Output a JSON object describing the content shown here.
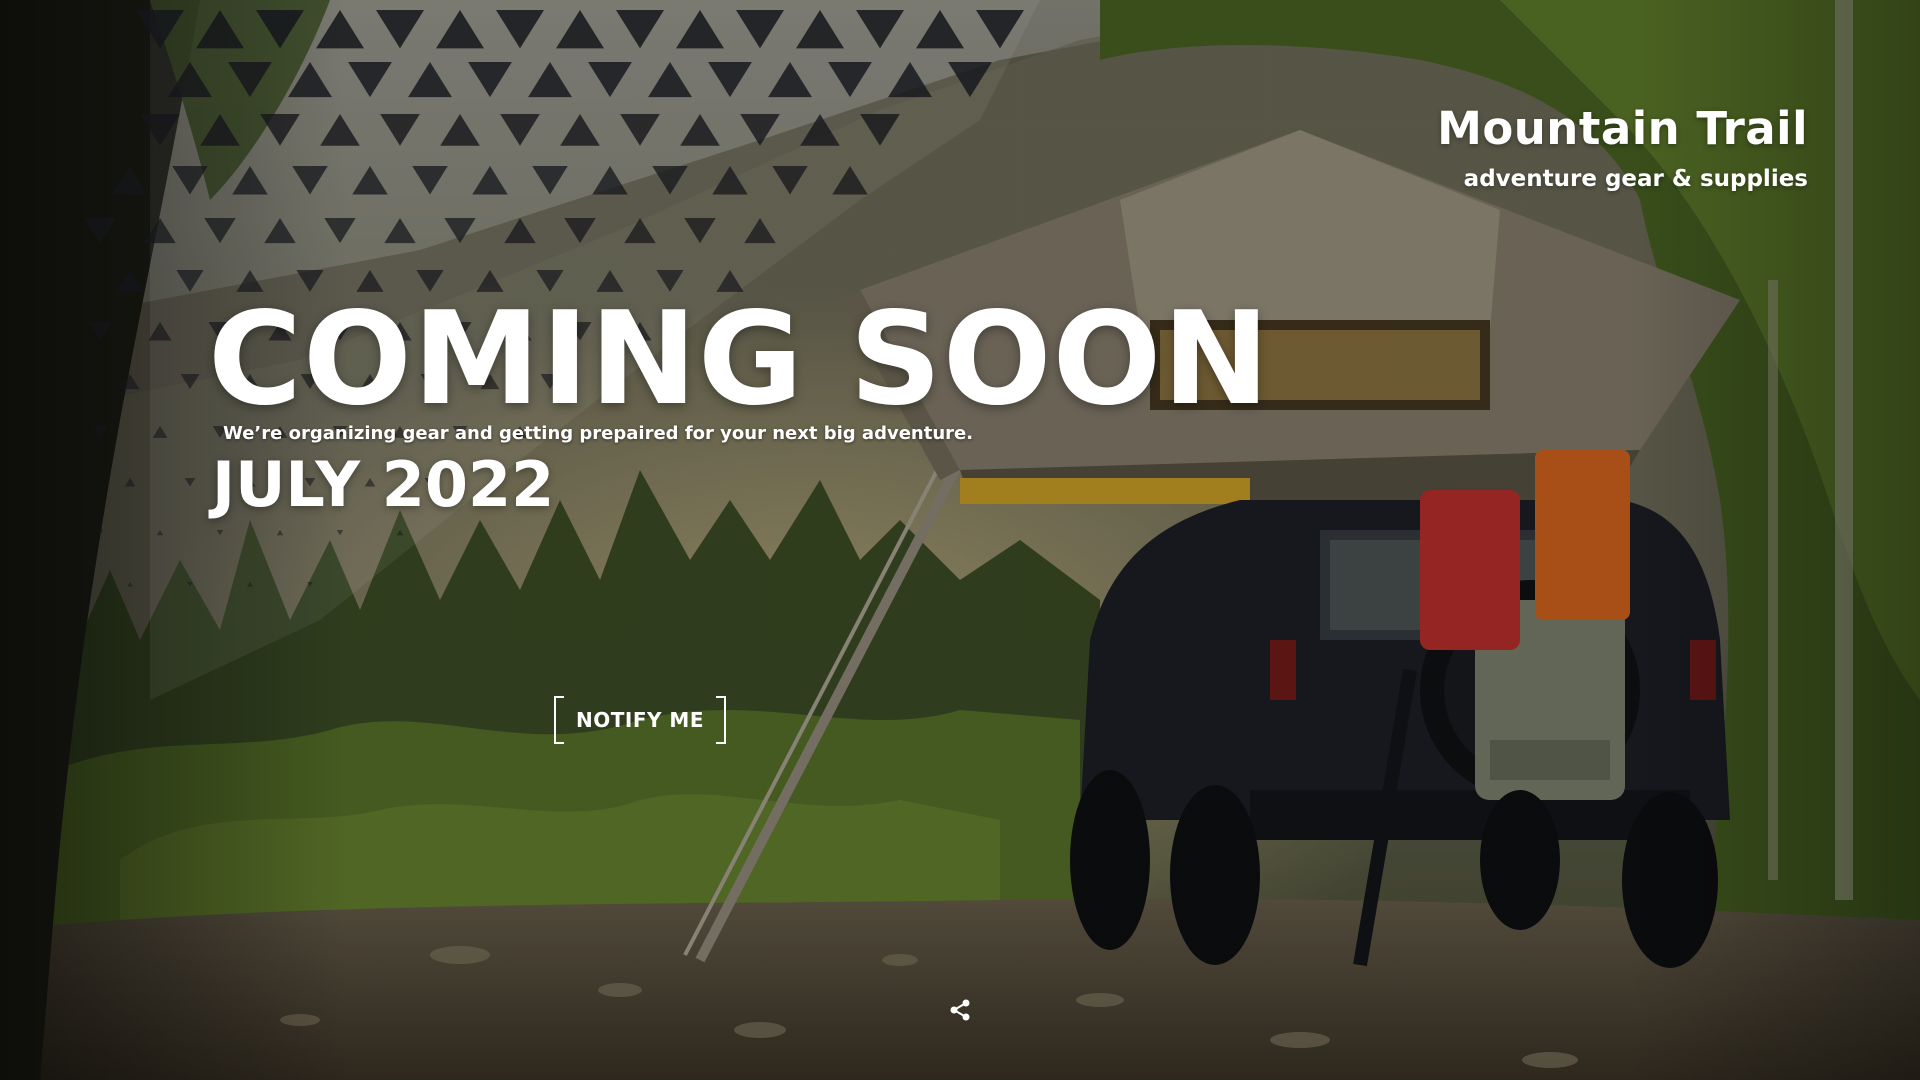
{
  "brand": {
    "name": "Mountain Trail",
    "tagline": "adventure gear & supplies"
  },
  "hero": {
    "headline": "COMING SOON",
    "subline": "We’re organizing gear and getting prepaired for your next big adventure.",
    "launch_date": "JULY 2022"
  },
  "actions": {
    "notify_label": "NOTIFY ME",
    "share_icon": "share-icon"
  },
  "colors": {
    "text": "#ffffff",
    "tent_canvas": "#9c9280",
    "tent_awning_trim": "#d9a928",
    "vehicle_body": "#1e2128",
    "jerry_can": "#c8322f",
    "traction_board": "#e36a1f",
    "forest_green": "#4f6a28"
  }
}
